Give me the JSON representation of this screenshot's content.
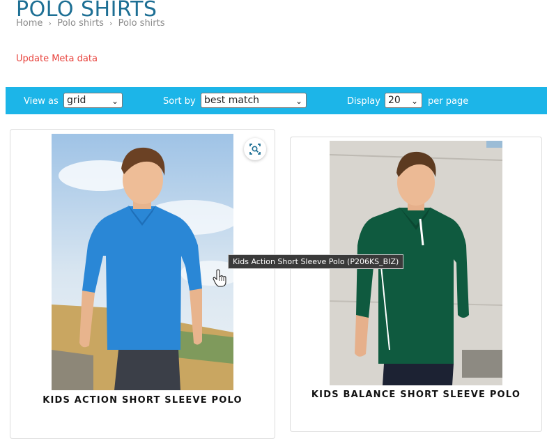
{
  "header": {
    "title": "POLO SHIRTS",
    "breadcrumb": [
      "Home",
      "Polo shirts",
      "Polo shirts"
    ]
  },
  "admin": {
    "meta_link": "Update Meta data"
  },
  "toolbar": {
    "view_label": "View as",
    "view_value": "grid",
    "sort_label": "Sort by",
    "sort_value": "best match",
    "display_label": "Display",
    "display_value": "20",
    "per_page_label": "per page"
  },
  "products": [
    {
      "name": "KIDS ACTION SHORT SLEEVE POLO",
      "shirt_color": "#2a87d6"
    },
    {
      "name": "KIDS BALANCE SHORT SLEEVE POLO",
      "shirt_color": "#0f5a3f"
    }
  ],
  "tooltip": {
    "text": "Kids Action Short Sleeve Polo (P206KS_BIZ)"
  },
  "colors": {
    "title": "#1d6f94",
    "accent": "#1cb5e8",
    "meta_link": "#e8433d"
  },
  "icons": [
    "chevron-right-icon",
    "chevron-down-icon",
    "zoom-icon",
    "hand-cursor-icon"
  ]
}
